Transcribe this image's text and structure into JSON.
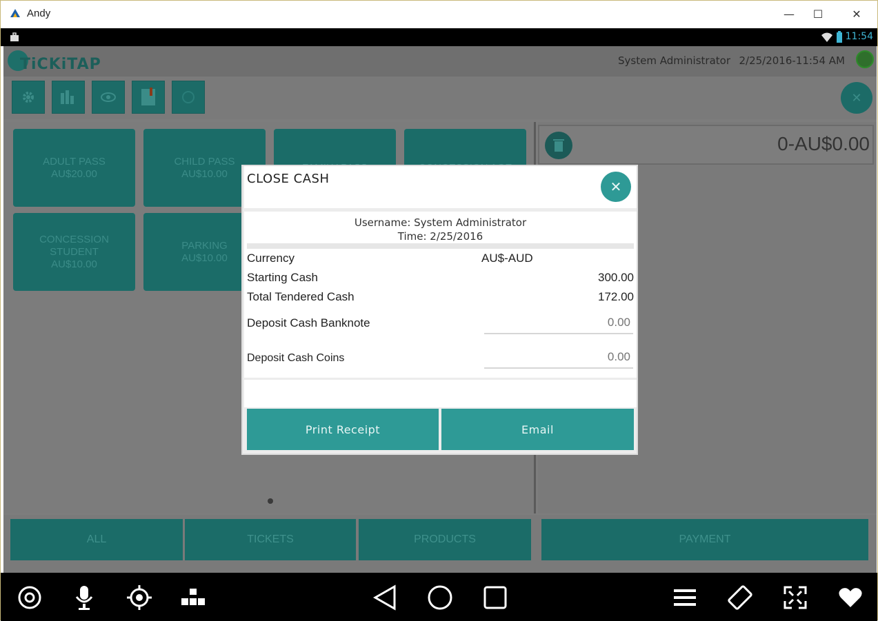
{
  "window": {
    "title": "Andy",
    "minimize": "—",
    "maximize": "☐",
    "close": "✕"
  },
  "statusbar": {
    "time": "11:54"
  },
  "header": {
    "brand": "TiCKiTAP",
    "user": "System Administrator",
    "datetime": "2/25/2016-11:54 AM"
  },
  "toolbar": {
    "buttons": [
      "gear-icon",
      "chart-icon",
      "eye-icon",
      "report-icon",
      "history-icon"
    ],
    "close_icon": "✕"
  },
  "products": [
    {
      "line1": "ADULT PASS",
      "line2": "AU$20.00"
    },
    {
      "line1": "CHILD PASS",
      "line2": "AU$10.00"
    },
    {
      "line1": "FAMILY PASS",
      "line2": ""
    },
    {
      "line1": "CONCESSION AGE",
      "line2": ""
    },
    {
      "line1": "CONCESSION",
      "line2": "STUDENT",
      "line3": "AU$10.00"
    },
    {
      "line1": "PARKING",
      "line2": "AU$10.00"
    }
  ],
  "cart": {
    "total": "0-AU$0.00"
  },
  "filters": {
    "all": "ALL",
    "tickets": "TICKETS",
    "products": "PRODUCTS",
    "payment": "PAYMENT"
  },
  "dialog": {
    "title": "CLOSE CASH",
    "close_icon": "✕",
    "username_line": "Username: System Administrator",
    "time_line": "Time: 2/25/2016",
    "currency_label": "Currency",
    "currency_value": "AU$-AUD",
    "starting_label": "Starting Cash",
    "starting_value": "300.00",
    "tendered_label": "Total Tendered Cash",
    "tendered_value": "172.00",
    "banknote_label": "Deposit Cash Banknote",
    "banknote_placeholder": "0.00",
    "coins_label": "Deposit Cash Coins",
    "coins_placeholder": "0.00",
    "print_label": "Print Receipt",
    "email_label": "Email"
  },
  "colors": {
    "teal": "#2e9a96",
    "teal_dim": "#1b6c68",
    "overlay": "#7a7a7a"
  }
}
